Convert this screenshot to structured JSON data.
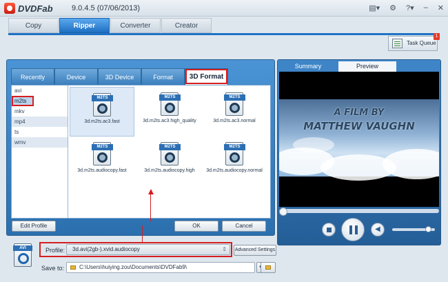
{
  "app": {
    "brand": "DVDFab",
    "version": "9.0.4.5 (07/06/2013)"
  },
  "main_tabs": [
    "Copy",
    "Ripper",
    "Converter",
    "Creator"
  ],
  "task_queue": {
    "label": "Task Queue",
    "badge": "1"
  },
  "sub_tabs": [
    "Recently",
    "Device",
    "3D Device",
    "Format",
    "3D Format"
  ],
  "formats": [
    "avi",
    "m2ts",
    "mkv",
    "mp4",
    "ts",
    "wmv"
  ],
  "profiles": [
    "3d.m2ts.ac3.fast",
    "3d.m2ts.ac3.high_quality",
    "3d.m2ts.ac3.normal",
    "3d.m2ts.audiocopy.fast",
    "3d.m2ts.audiocopy.high",
    "3d.m2ts.audiocopy.normal"
  ],
  "file_badge": "M2TS",
  "buttons": {
    "edit_profile": "Edit Profile",
    "ok": "OK",
    "cancel": "Cancel",
    "advanced_settings": "Advanced Settings"
  },
  "preview_tabs": [
    "Summary",
    "Preview"
  ],
  "video_text": {
    "line1": "A FILM BY",
    "line2": "MATTHEW VAUGHN"
  },
  "bottom": {
    "output_badge": "AVI",
    "profile_label": "Profile:",
    "profile_value": "3d.avi(2gb-).xvid.audiocopy",
    "save_label": "Save to:",
    "save_path": "C:\\Users\\huiying.zou\\Documents\\DVDFab9\\"
  },
  "colors": {
    "accent": "#1f72c6",
    "highlight": "#d51e1e"
  },
  "icons": [
    "menu-icon",
    "gear-icon",
    "help-icon",
    "minimize-icon",
    "close-icon",
    "stop-icon",
    "pause-icon",
    "volume-icon",
    "folder-icon"
  ]
}
